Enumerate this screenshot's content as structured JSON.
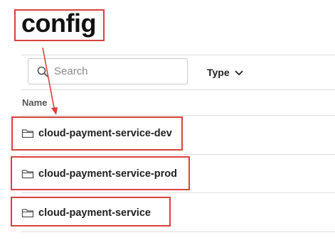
{
  "page": {
    "title": "config"
  },
  "search": {
    "placeholder": "Search",
    "value": ""
  },
  "filter": {
    "type_label": "Type"
  },
  "table": {
    "columns": [
      {
        "label": "Name"
      }
    ],
    "rows": [
      {
        "name": "cloud-payment-service-dev",
        "icon": "folder-icon"
      },
      {
        "name": "cloud-payment-service-prod",
        "icon": "folder-icon"
      },
      {
        "name": "cloud-payment-service",
        "icon": "folder-icon"
      }
    ]
  },
  "annotation": {
    "color": "#d9413c"
  }
}
